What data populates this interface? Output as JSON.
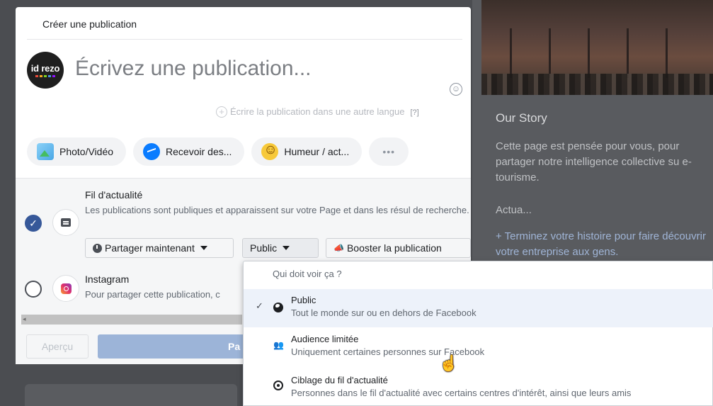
{
  "composer": {
    "title": "Créer une publication",
    "avatar_text": "id rezo",
    "placeholder": "Écrivez une publication...",
    "translate_label": "Écrire la publication dans une autre langue",
    "translate_help": "[?]",
    "actions": [
      {
        "label": "Photo/Vidéo",
        "icon": "photo-video-icon"
      },
      {
        "label": "Recevoir des...",
        "icon": "messenger-icon"
      },
      {
        "label": "Humeur / act...",
        "icon": "mood-emoji-icon"
      },
      {
        "label": "•••",
        "icon": "more-icon"
      }
    ]
  },
  "feed": {
    "title": "Fil d'actualité",
    "description": "Les publications sont publiques et apparaissent sur votre Page et dans les résul de recherche.",
    "share_now": "Partager maintenant",
    "audience": "Public",
    "boost": "Booster la publication"
  },
  "instagram": {
    "title": "Instagram",
    "description": "Pour partager cette publication, c"
  },
  "footer": {
    "preview": "Aperçu",
    "publish": "Pa"
  },
  "dropdown": {
    "header": "Qui doit voir ça ?",
    "options": [
      {
        "label": "Public",
        "sub": "Tout le monde sur ou en dehors de Facebook",
        "selected": true,
        "icon": "globe-icon"
      },
      {
        "label": "Audience limitée",
        "sub": "Uniquement certaines personnes sur Facebook",
        "selected": false,
        "icon": "people-icon"
      },
      {
        "label": "Ciblage du fil d'actualité",
        "sub": "Personnes dans le fil d'actualité avec certains centres d'intérêt, ainsi que leurs amis",
        "selected": false,
        "icon": "target-icon"
      }
    ]
  },
  "background": {
    "story_title": "Our Story",
    "story_text": "Cette page est pensée pour vous, pour partager notre intelligence collective su e-tourisme.",
    "actua": "Actua...",
    "story_link": "+ Terminez votre histoire pour faire découvrir votre entreprise aux gens."
  },
  "colors": {
    "accent": "#365899",
    "selected_bg": "#edf2fa",
    "publish_disabled": "#9cb4d8"
  }
}
